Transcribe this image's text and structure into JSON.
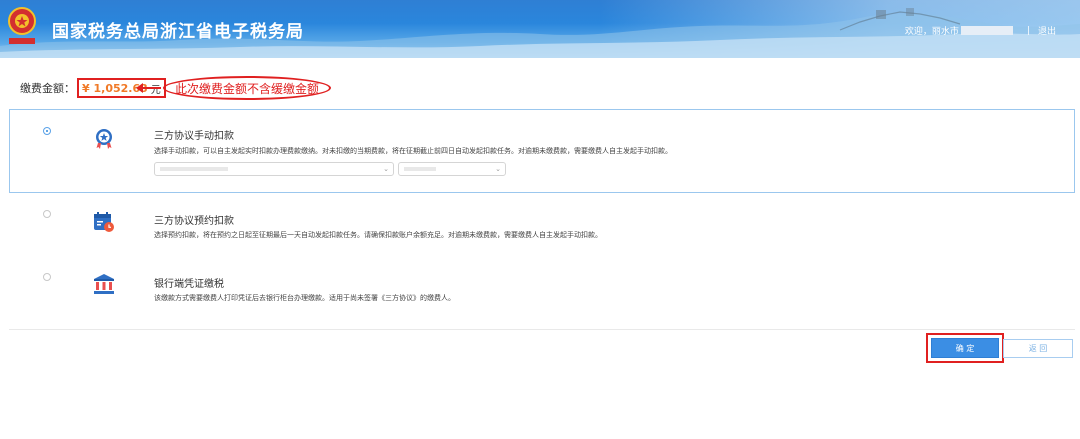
{
  "header": {
    "title": "国家税务总局浙江省电子税务局",
    "welcome": "欢迎，丽水市",
    "separator": "|",
    "logout": "退出"
  },
  "payment": {
    "label": "缴费金额：",
    "amount": "¥ 1,052.63",
    "unit": "元",
    "callout": "此次缴费金额不含缓缴金额"
  },
  "options": [
    {
      "title": "三方协议手动扣款",
      "desc": "选择手动扣款，可以自主发起实时扣款办理费款缴纳。对未扣缴的当期费款，将在征期截止前四日自动发起扣款任务。对逾期未缴费款，需要缴费人自主发起手动扣款。",
      "selected": true,
      "icon": "badge-star-icon"
    },
    {
      "title": "三方协议预约扣款",
      "desc": "选择预约扣款，将在预约之日起至征期最后一天自动发起扣款任务。请确保扣款账户余额充足。对逾期未缴费款，需要缴费人自主发起手动扣款。",
      "selected": false,
      "icon": "calendar-clock-icon"
    },
    {
      "title": "银行端凭证缴税",
      "desc": "该缴款方式需要缴费人打印凭证后去银行柜台办理缴款。适用于尚未签署《三方协议》的缴费人。",
      "selected": false,
      "icon": "bank-icon"
    }
  ],
  "buttons": {
    "confirm": "确 定",
    "back": "返 回"
  },
  "colors": {
    "accent": "#3b8ee4",
    "amount": "#f07a28",
    "annotation": "#e02020"
  }
}
